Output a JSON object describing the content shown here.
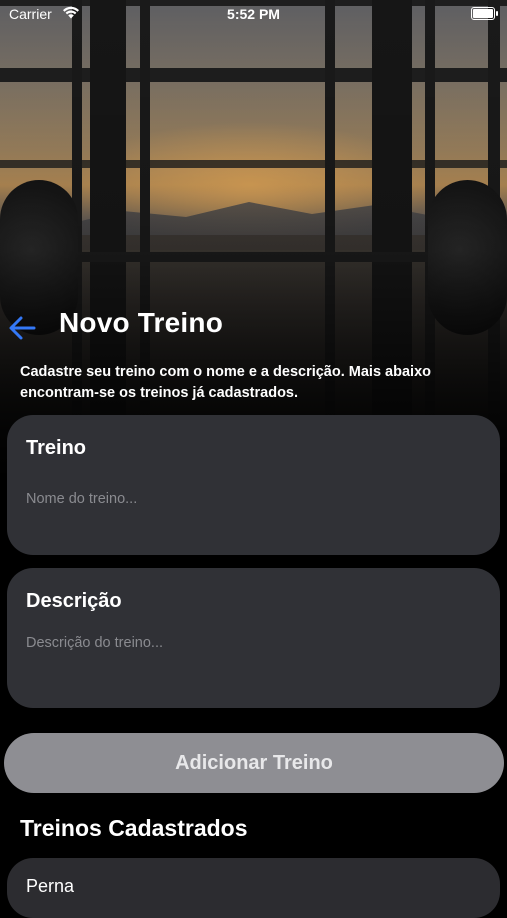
{
  "status_bar": {
    "carrier": "Carrier",
    "time": "5:52 PM",
    "icons": [
      "wifi-icon",
      "battery-icon"
    ]
  },
  "header": {
    "back_icon": "arrow-left-icon",
    "title": "Novo Treino"
  },
  "intro": "Cadastre seu treino com o nome e a descrição. Mais abaixo encontram-se os treinos já cadastrados.",
  "form": {
    "name_label": "Treino",
    "name_value": "",
    "name_placeholder": "Nome do treino...",
    "description_label": "Descrição",
    "description_value": "",
    "description_placeholder": "Descrição do treino..."
  },
  "add_button_label": "Adicionar Treino",
  "registered": {
    "title": "Treinos Cadastrados",
    "items": [
      {
        "name": "Perna"
      }
    ]
  },
  "colors": {
    "accent": "#3478F6",
    "card_background": "#34353A",
    "button_background": "#8E8E93",
    "placeholder": "#8A8B90"
  }
}
